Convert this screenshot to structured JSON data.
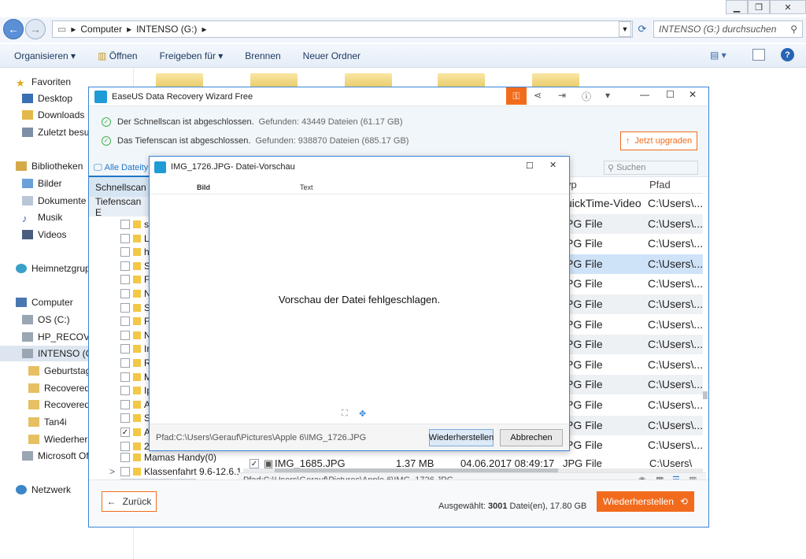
{
  "explorer": {
    "address": [
      "Computer",
      "INTENSO (G:)"
    ],
    "search_placeholder": "INTENSO (G:) durchsuchen",
    "toolbar": [
      "Organisieren",
      "Öffnen",
      "Freigeben für",
      "Brennen",
      "Neuer Ordner"
    ],
    "tree": {
      "favorites": "Favoriten",
      "fav_items": [
        "Desktop",
        "Downloads",
        "Zuletzt besu"
      ],
      "libraries": "Bibliotheken",
      "lib_items": [
        "Bilder",
        "Dokumente",
        "Musik",
        "Videos"
      ],
      "homegroup": "Heimnetzgrup",
      "computer": "Computer",
      "drives": [
        "OS (C:)",
        "HP_RECOVER",
        "INTENSO (G"
      ],
      "g_items": [
        "Geburtstag",
        "Recovered",
        "Recovered",
        "Tan4i",
        "Wiederhers"
      ],
      "msoffice": "Microsoft Of",
      "network": "Netzwerk"
    }
  },
  "easeus": {
    "title": "EaseUS Data Recovery Wizard Free",
    "status1_text": "Der Schnellscan ist abgeschlossen.",
    "status1_found": "Gefunden: 43449 Dateien (61.17 GB)",
    "status2_text": "Das Tiefenscan ist abgeschlossen.",
    "status2_found": "Gefunden: 938870 Dateien (685.17 GB)",
    "upgrade": "Jetzt upgraden",
    "tab_all": "Alle Dateity",
    "tab_quick": "Schnellscan",
    "tab_deep": "Tiefenscan E",
    "search_placeholder": "Suchen",
    "col_type": "yp",
    "col_path": "Pfad",
    "rows": [
      {
        "type": "uickTime-Video",
        "path": "C:\\Users\\..."
      },
      {
        "type": "PG File",
        "path": "C:\\Users\\..."
      },
      {
        "type": "PG File",
        "path": "C:\\Users\\..."
      },
      {
        "type": "PG File",
        "path": "C:\\Users\\..."
      },
      {
        "type": "PG File",
        "path": "C:\\Users\\..."
      },
      {
        "type": "PG File",
        "path": "C:\\Users\\..."
      },
      {
        "type": "PG File",
        "path": "C:\\Users\\..."
      },
      {
        "type": "PG File",
        "path": "C:\\Users\\..."
      },
      {
        "type": "PG File",
        "path": "C:\\Users\\..."
      },
      {
        "type": "PG File",
        "path": "C:\\Users\\..."
      },
      {
        "type": "PG File",
        "path": "C:\\Users\\..."
      },
      {
        "type": "PG File",
        "path": "C:\\Users\\..."
      },
      {
        "type": "PG File",
        "path": "C:\\Users\\..."
      }
    ],
    "left_items": [
      "s",
      "L",
      "h",
      "S",
      "F",
      "N",
      "S",
      "F",
      "N",
      "Ir",
      "R",
      "M",
      "Ip",
      "A",
      "S",
      "A",
      "2"
    ],
    "left_extra": [
      "Mamas Handy(0)",
      "Klassenfahrt 9.6-12.6.1"
    ],
    "last_row": {
      "name": "IMG_1685.JPG",
      "size": "1.37 MB",
      "date": "04.06.2017 08:49:17",
      "type": "JPG File",
      "path": "C:\\Users\\"
    },
    "path_bar": "Pfad:C:\\Users\\Gerauf\\Pictures\\Apple 6\\IMG_1726.JPG",
    "back": "Zurück",
    "selected_label": "Ausgewählt:",
    "selected_count": "3001",
    "selected_unit": "Datei(en),",
    "selected_size": "17.80 GB",
    "recover": "Wiederherstellen"
  },
  "preview": {
    "title": "IMG_1726.JPG- Datei-Vorschau",
    "col_image": "Bild",
    "col_text": "Text",
    "message": "Vorschau der Datei fehlgeschlagen.",
    "path": "Pfad:C:\\Users\\Gerauf\\Pictures\\Apple 6\\IMG_1726.JPG",
    "recover": "Wiederherstellen",
    "cancel": "Abbrechen"
  }
}
